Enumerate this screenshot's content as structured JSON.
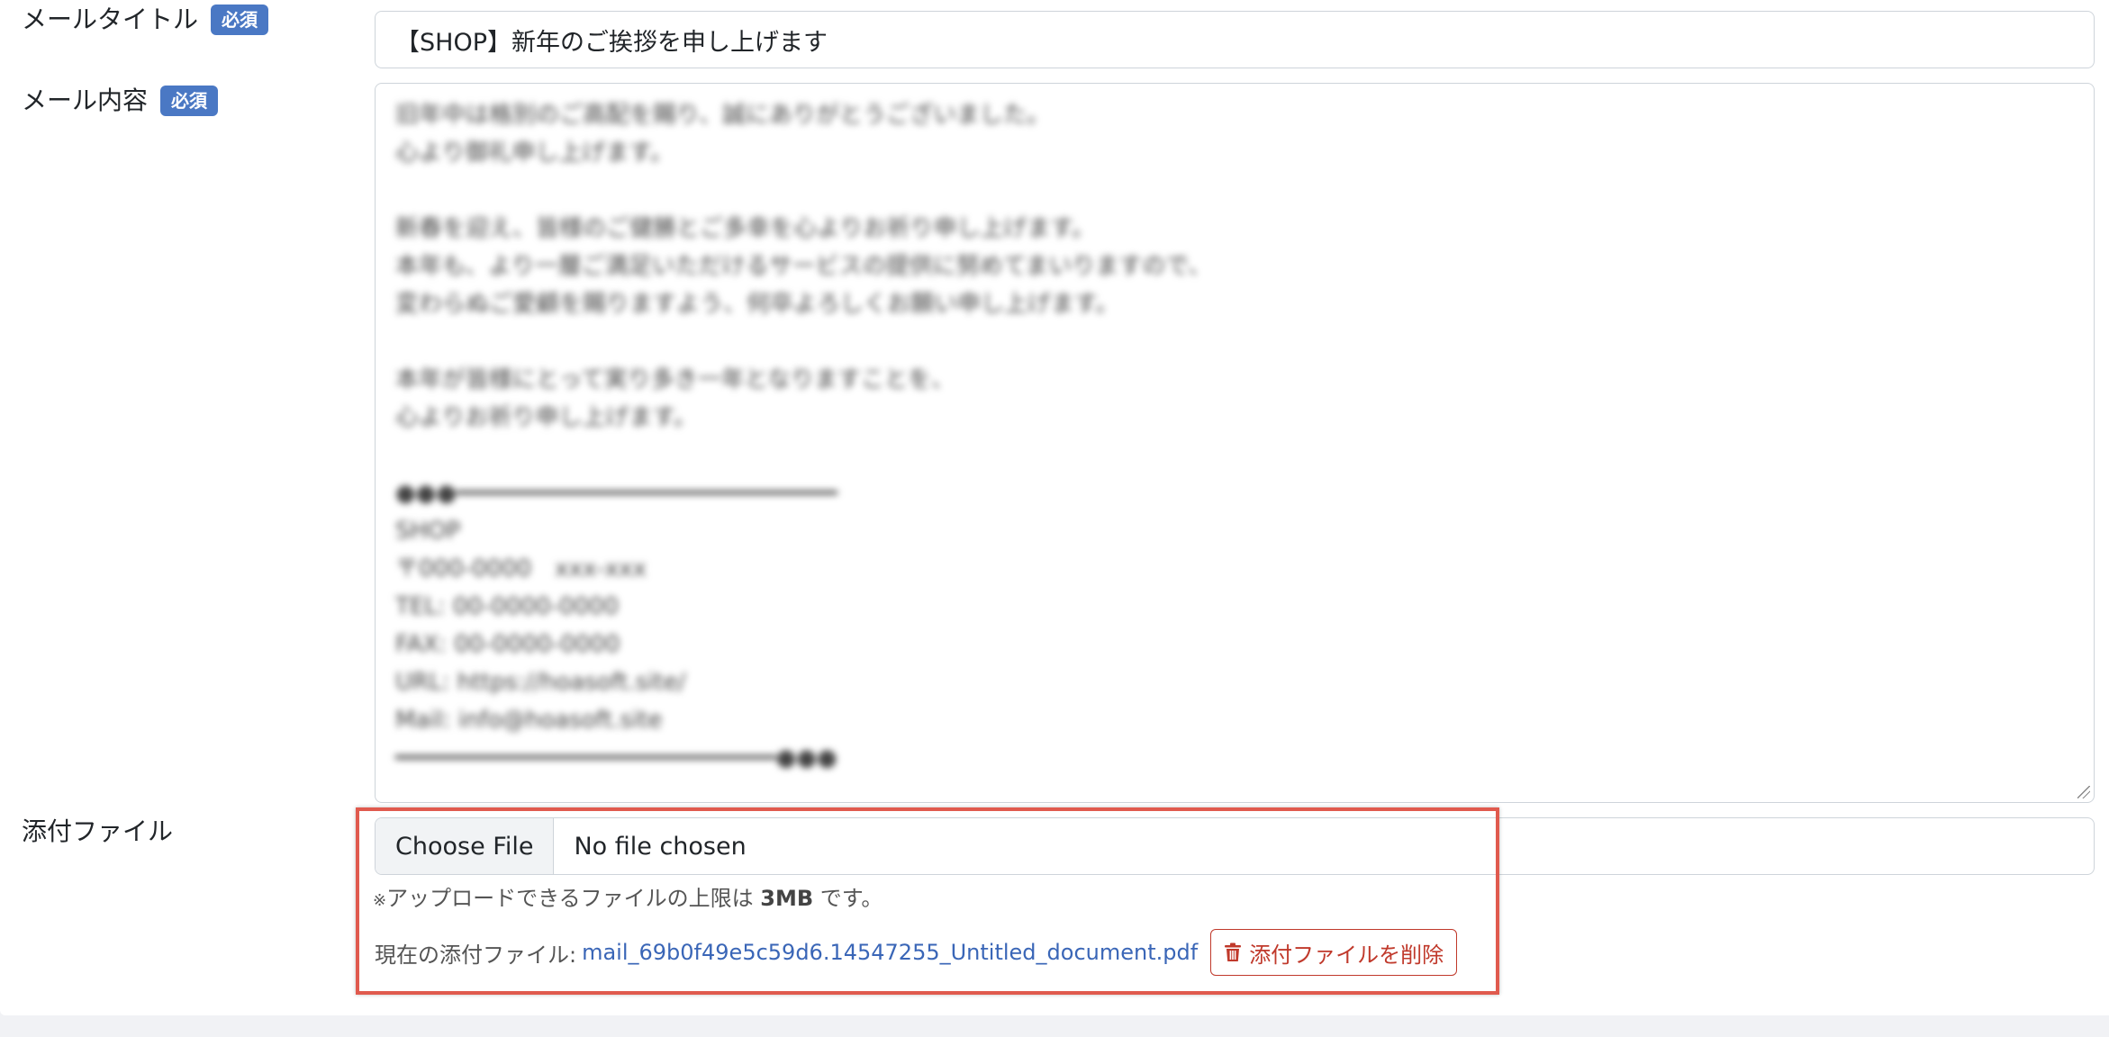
{
  "form": {
    "title_label": "メールタイトル",
    "content_label": "メール内容",
    "attachment_label": "添付ファイル",
    "required_badge": "必須",
    "title_value": "【SHOP】新年のご挨拶を申し上げます",
    "content_value": "旧年中は格別のご高配を賜り、誠にありがとうございました。\n心より御礼申し上げます。\n\n新春を迎え、皆様のご健勝とご多幸を心よりお祈り申し上げます。\n本年も、より一層ご満足いただけるサービスの提供に努めてまいりますので、\n変わらぬご愛顧を賜りますよう、何卒よろしくお願い申し上げます。\n\n本年が皆様にとって実り多き一年となりますことを、\n心よりお祈り申し上げます。\n\n●●●━━━━━━━━━━━━━━━━━━━━━━━━━━━\nSHOP\n〒000-0000　xxx-xxx\nTEL: 00-0000-0000\nFAX: 00-0000-0000\nURL: https://hoasoft.site/\nMail: info@hoasoft.site\n━━━━━━━━━━━━━━━━━━━━━━━━━━━●●●"
  },
  "file": {
    "choose_label": "Choose File",
    "no_file_text": "No file chosen",
    "note_mark": "※",
    "note_prefix": "アップロードできるファイルの上限は",
    "note_limit": "3MB",
    "note_suffix": "です。",
    "current_label": "現在の添付ファイル:",
    "current_filename": "mail_69b0f49e5c59d6.14547255_Untitled_document.pdf",
    "delete_label": "添付ファイルを削除"
  },
  "colors": {
    "badge": "#4a78c4",
    "link": "#3a66b7",
    "danger": "#c0392b",
    "highlight": "#e05a4e"
  },
  "icons": {
    "delete": "trash-icon"
  }
}
